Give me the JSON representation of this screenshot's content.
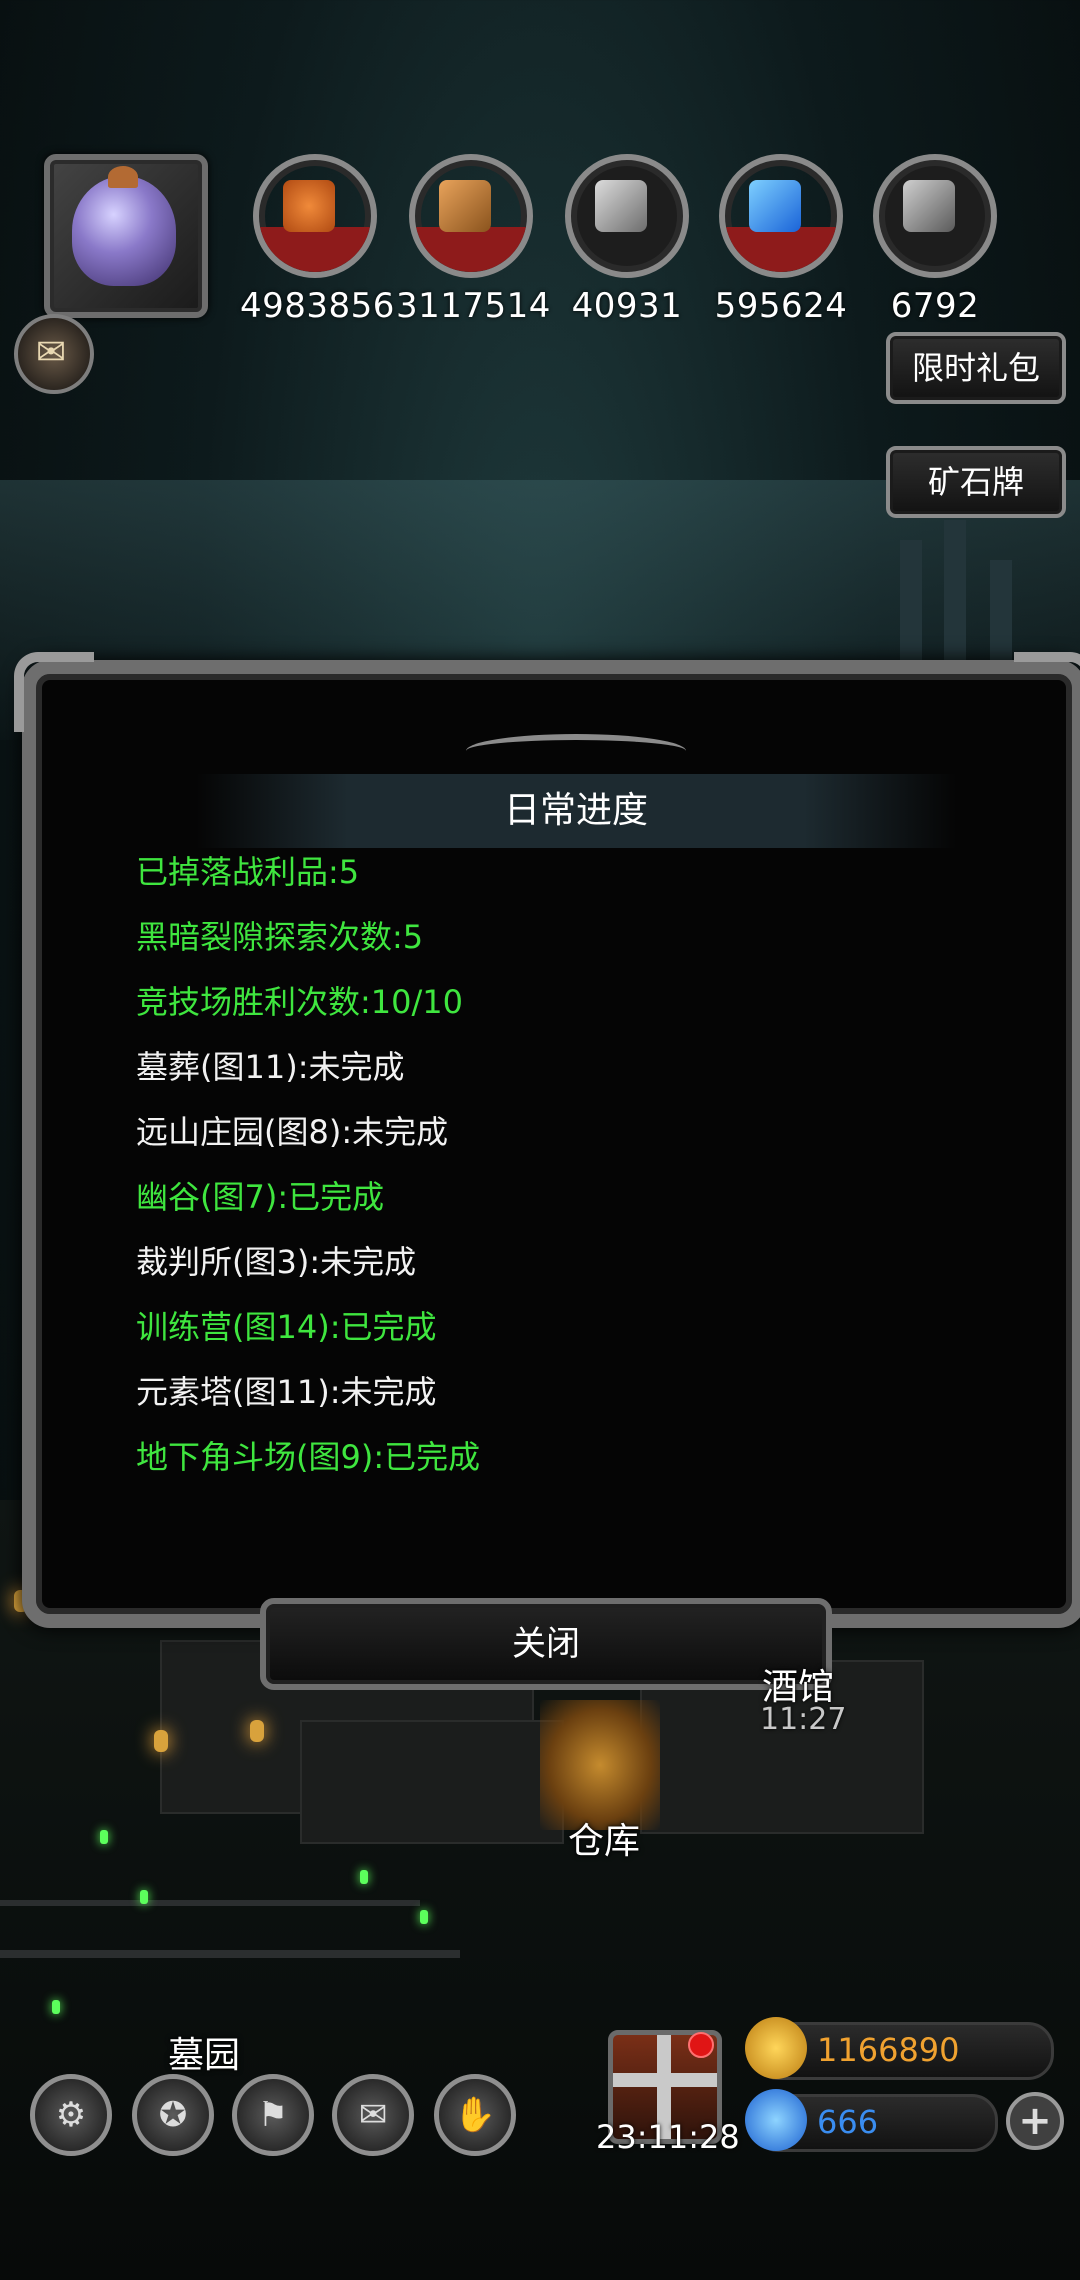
{
  "resources": [
    {
      "icon": "meat-resource-icon",
      "value": "4983856"
    },
    {
      "icon": "wood-resource-icon",
      "value": "3117514"
    },
    {
      "icon": "iron-resource-icon",
      "value": "40931"
    },
    {
      "icon": "crystal-resource-icon",
      "value": "595624"
    },
    {
      "icon": "ore-resource-icon",
      "value": "6792"
    }
  ],
  "side_buttons": {
    "limited_pack": "限时礼包",
    "ore_card": "矿石牌"
  },
  "dialog": {
    "title": "日常进度",
    "rows": [
      {
        "text": "已掉落战利品:5",
        "done": true
      },
      {
        "text": "黑暗裂隙探索次数:5",
        "done": true
      },
      {
        "text": "竞技场胜利次数:10/10",
        "done": true
      },
      {
        "text": "墓葬(图11):未完成",
        "done": false
      },
      {
        "text": "远山庄园(图8):未完成",
        "done": false
      },
      {
        "text": "幽谷(图7):已完成",
        "done": true
      },
      {
        "text": "裁判所(图3):未完成",
        "done": false
      },
      {
        "text": "训练营(图14):已完成",
        "done": true
      },
      {
        "text": "元素塔(图11):未完成",
        "done": false
      },
      {
        "text": "地下角斗场(图9):已完成",
        "done": true
      }
    ],
    "close_label": "关闭"
  },
  "town": {
    "tavern_label": "酒馆",
    "tavern_time": "11:27",
    "warehouse_label": "仓库",
    "graveyard_label": "墓园"
  },
  "bottom_bar": {
    "gift_timer": "23:11:28",
    "gold": "1166890",
    "gems": "666",
    "plus": "+",
    "menu_icons": [
      "settings-gear-icon",
      "achievement-star-icon",
      "hero-banner-icon",
      "mail-icon",
      "handshake-icon"
    ]
  },
  "colors": {
    "done_text": "#3fe63f",
    "todo_text": "#f2f2f2",
    "gold_text": "#f0a230",
    "gem_text": "#3a8df0"
  }
}
